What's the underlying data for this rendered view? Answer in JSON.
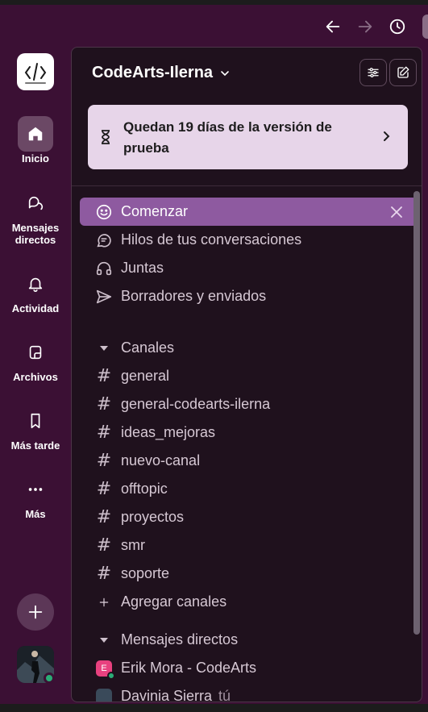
{
  "colors": {
    "background": "#3b1034",
    "panel": "#1f111d",
    "active_row": "#8e5aa0",
    "trial_banner": "#e7d5e9",
    "presence": "#2bac76"
  },
  "titlebar": {
    "back_icon": "arrow-left-icon",
    "forward_icon": "arrow-right-icon",
    "history_icon": "clock-icon"
  },
  "rail": {
    "items": [
      {
        "label": "Inicio",
        "icon": "home-icon",
        "active": true
      },
      {
        "label": "Mensajes directos",
        "icon": "messages-icon",
        "active": false
      },
      {
        "label": "Actividad",
        "icon": "bell-icon",
        "active": false
      },
      {
        "label": "Archivos",
        "icon": "files-icon",
        "active": false
      },
      {
        "label": "Más tarde",
        "icon": "bookmark-icon",
        "active": false
      },
      {
        "label": "Más",
        "icon": "more-icon",
        "active": false
      }
    ]
  },
  "workspace": {
    "name": "CodeArts-Ilerna"
  },
  "trial": {
    "text": "Quedan 19 días de la versión de prueba"
  },
  "nav": [
    {
      "label": "Comenzar",
      "icon": "smiley-icon",
      "active": true
    },
    {
      "label": "Hilos de tus conversaciones",
      "icon": "threads-icon",
      "active": false
    },
    {
      "label": "Juntas",
      "icon": "headphones-icon",
      "active": false
    },
    {
      "label": "Borradores y enviados",
      "icon": "send-icon",
      "active": false
    }
  ],
  "channels": {
    "title": "Canales",
    "items": [
      "general",
      "general-codearts-ilerna",
      "ideas_mejoras",
      "nuevo-canal",
      "offtopic",
      "proyectos",
      "smr",
      "soporte"
    ],
    "add_label": "Agregar canales",
    "hash": "#"
  },
  "dms": {
    "title": "Mensajes directos",
    "items": [
      {
        "name": "Erik Mora - CodeArts",
        "initial": "E"
      },
      {
        "name": "Davinia Sierra",
        "suffix": "tú"
      }
    ]
  }
}
